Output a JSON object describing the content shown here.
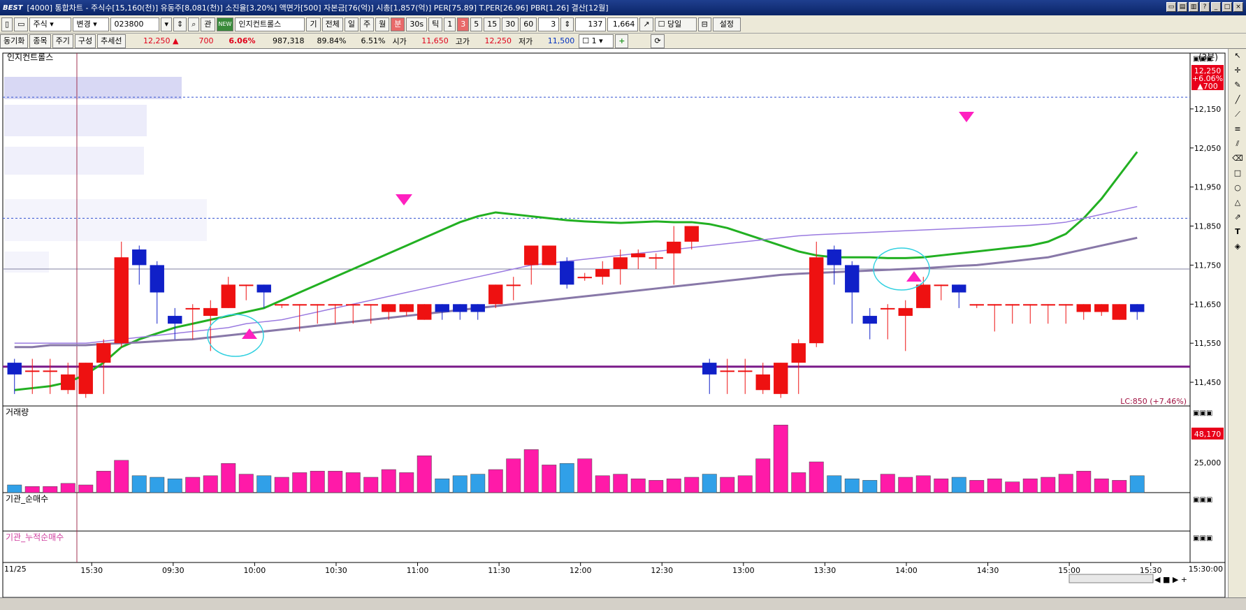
{
  "title": {
    "app": "BEST",
    "text": "[4000] 통합차트 - 주식수[15,160(천)] 유동주[8,081(천)] 소진율[3.20%] 액면가[500] 자본금[76(억)] 시총[1,857(억)] PER[75.89] T.PER[26.96] PBR[1.26] 결산[12월]"
  },
  "toolbar": {
    "type_select": "주식",
    "change_label": "변경",
    "code_value": "023800",
    "rel_label": "관",
    "badge_label": "NEW",
    "name_value": "인지컨트롤스",
    "gi_label": "기",
    "all_label": "전체",
    "day_label": "일",
    "week_label": "주",
    "month_label": "월",
    "min_label": "분",
    "sec_label": "30s",
    "tick_label": "틱",
    "intervals": [
      "1",
      "3",
      "5",
      "15",
      "30",
      "60"
    ],
    "period_value": "3",
    "count_value": "137",
    "total_value": "1,664",
    "today_label": "당일",
    "settings_label": "설정"
  },
  "infobar": {
    "sync_label": "동기화",
    "stock_label": "종목",
    "cycle_label": "주기",
    "compose_label": "구성",
    "trend_label": "추세선",
    "price": "12,250",
    "change": "700",
    "rate": "6.06%",
    "volume": "987,318",
    "vol_ratio": "89.84%",
    "turnover": "6.51%",
    "open_label": "시가",
    "open": "11,650",
    "high_label": "고가",
    "high": "12,250",
    "low_label": "저가",
    "low": "11,500",
    "count_select": "1"
  },
  "chart": {
    "stock_name": "인지컨트롤스",
    "interval_label": "(3분)",
    "price_label": "12,250",
    "price_change_label": "+6.06%",
    "price_delta_label": "▲700",
    "lc_label": "LC:850 (+7.46%)",
    "volume_panel_label": "거래량",
    "volume_box_label": "48,170",
    "volume_tick_label": "25,000",
    "inst_panel_label": "기관_순매수",
    "inst_cum_panel_label": "기관_누적순매수",
    "date_label": "11/25",
    "end_time_label": "15:30:00"
  },
  "chart_data": {
    "type": "candlestick",
    "price_ticks": [
      12150,
      12050,
      11950,
      11850,
      11750,
      11650,
      11550,
      11450
    ],
    "time_ticks": [
      {
        "label": "15:30",
        "i": 4
      },
      {
        "label": "09:30",
        "i": 9
      },
      {
        "label": "10:00",
        "i": 14
      },
      {
        "label": "10:30",
        "i": 19
      },
      {
        "label": "11:00",
        "i": 24
      },
      {
        "label": "11:30",
        "i": 29
      },
      {
        "label": "12:00",
        "i": 34
      },
      {
        "label": "12:30",
        "i": 39
      },
      {
        "label": "13:00",
        "i": 44
      },
      {
        "label": "13:30",
        "i": 49
      },
      {
        "label": "14:00",
        "i": 54
      },
      {
        "label": "14:30",
        "i": 59
      },
      {
        "label": "15:00",
        "i": 64
      },
      {
        "label": "15:30",
        "i": 69
      }
    ],
    "candles": [
      {
        "o": 11500,
        "h": 11510,
        "l": 11420,
        "c": 11470
      },
      {
        "o": 11480,
        "h": 11510,
        "l": 11420,
        "c": 11480
      },
      {
        "o": 11480,
        "h": 11510,
        "l": 11420,
        "c": 11480
      },
      {
        "o": 11430,
        "h": 11500,
        "l": 11420,
        "c": 11470
      },
      {
        "o": 11420,
        "h": 11500,
        "l": 11410,
        "c": 11500
      },
      {
        "o": 11500,
        "h": 11560,
        "l": 11420,
        "c": 11550
      },
      {
        "o": 11550,
        "h": 11810,
        "l": 11540,
        "c": 11770
      },
      {
        "o": 11790,
        "h": 11800,
        "l": 11700,
        "c": 11750
      },
      {
        "o": 11750,
        "h": 11760,
        "l": 11600,
        "c": 11680
      },
      {
        "o": 11620,
        "h": 11640,
        "l": 11560,
        "c": 11600
      },
      {
        "o": 11640,
        "h": 11650,
        "l": 11560,
        "c": 11640
      },
      {
        "o": 11620,
        "h": 11660,
        "l": 11530,
        "c": 11640
      },
      {
        "o": 11640,
        "h": 11720,
        "l": 11640,
        "c": 11700
      },
      {
        "o": 11700,
        "h": 11700,
        "l": 11660,
        "c": 11700
      },
      {
        "o": 11700,
        "h": 11700,
        "l": 11640,
        "c": 11680
      },
      {
        "o": 11650,
        "h": 11650,
        "l": 11640,
        "c": 11650
      },
      {
        "o": 11650,
        "h": 11650,
        "l": 11580,
        "c": 11650
      },
      {
        "o": 11650,
        "h": 11650,
        "l": 11600,
        "c": 11650
      },
      {
        "o": 11650,
        "h": 11650,
        "l": 11600,
        "c": 11650
      },
      {
        "o": 11650,
        "h": 11650,
        "l": 11600,
        "c": 11650
      },
      {
        "o": 11650,
        "h": 11650,
        "l": 11600,
        "c": 11650
      },
      {
        "o": 11630,
        "h": 11650,
        "l": 11610,
        "c": 11650
      },
      {
        "o": 11630,
        "h": 11650,
        "l": 11620,
        "c": 11650
      },
      {
        "o": 11610,
        "h": 11650,
        "l": 11610,
        "c": 11650
      },
      {
        "o": 11650,
        "h": 11650,
        "l": 11610,
        "c": 11630
      },
      {
        "o": 11650,
        "h": 11650,
        "l": 11610,
        "c": 11630
      },
      {
        "o": 11650,
        "h": 11650,
        "l": 11610,
        "c": 11630
      },
      {
        "o": 11650,
        "h": 11700,
        "l": 11640,
        "c": 11700
      },
      {
        "o": 11700,
        "h": 11720,
        "l": 11660,
        "c": 11700
      },
      {
        "o": 11750,
        "h": 11800,
        "l": 11700,
        "c": 11800
      },
      {
        "o": 11750,
        "h": 11800,
        "l": 11750,
        "c": 11800
      },
      {
        "o": 11760,
        "h": 11770,
        "l": 11690,
        "c": 11700
      },
      {
        "o": 11720,
        "h": 11730,
        "l": 11710,
        "c": 11720
      },
      {
        "o": 11720,
        "h": 11760,
        "l": 11700,
        "c": 11740
      },
      {
        "o": 11740,
        "h": 11790,
        "l": 11700,
        "c": 11770
      },
      {
        "o": 11770,
        "h": 11790,
        "l": 11740,
        "c": 11780
      },
      {
        "o": 11770,
        "h": 11780,
        "l": 11740,
        "c": 11770
      },
      {
        "o": 11780,
        "h": 11850,
        "l": 11700,
        "c": 11810
      },
      {
        "o": 11810,
        "h": 11850,
        "l": 11790,
        "c": 11850
      }
    ],
    "candle_count_note_hidden": "",
    "volume": [
      5,
      4,
      4,
      6,
      5,
      14,
      21,
      11,
      10,
      9,
      10,
      11,
      19,
      12,
      11,
      10,
      13,
      14,
      14,
      13,
      10,
      15,
      13,
      24,
      9,
      11,
      12,
      15,
      22,
      28,
      18,
      19,
      22,
      11,
      12,
      9,
      8,
      9,
      10,
      12,
      10,
      11,
      22,
      44,
      13,
      20,
      11,
      9,
      8,
      12,
      10,
      11,
      9,
      10,
      8,
      9,
      7,
      9,
      10,
      12,
      14,
      9,
      8,
      11
    ]
  }
}
